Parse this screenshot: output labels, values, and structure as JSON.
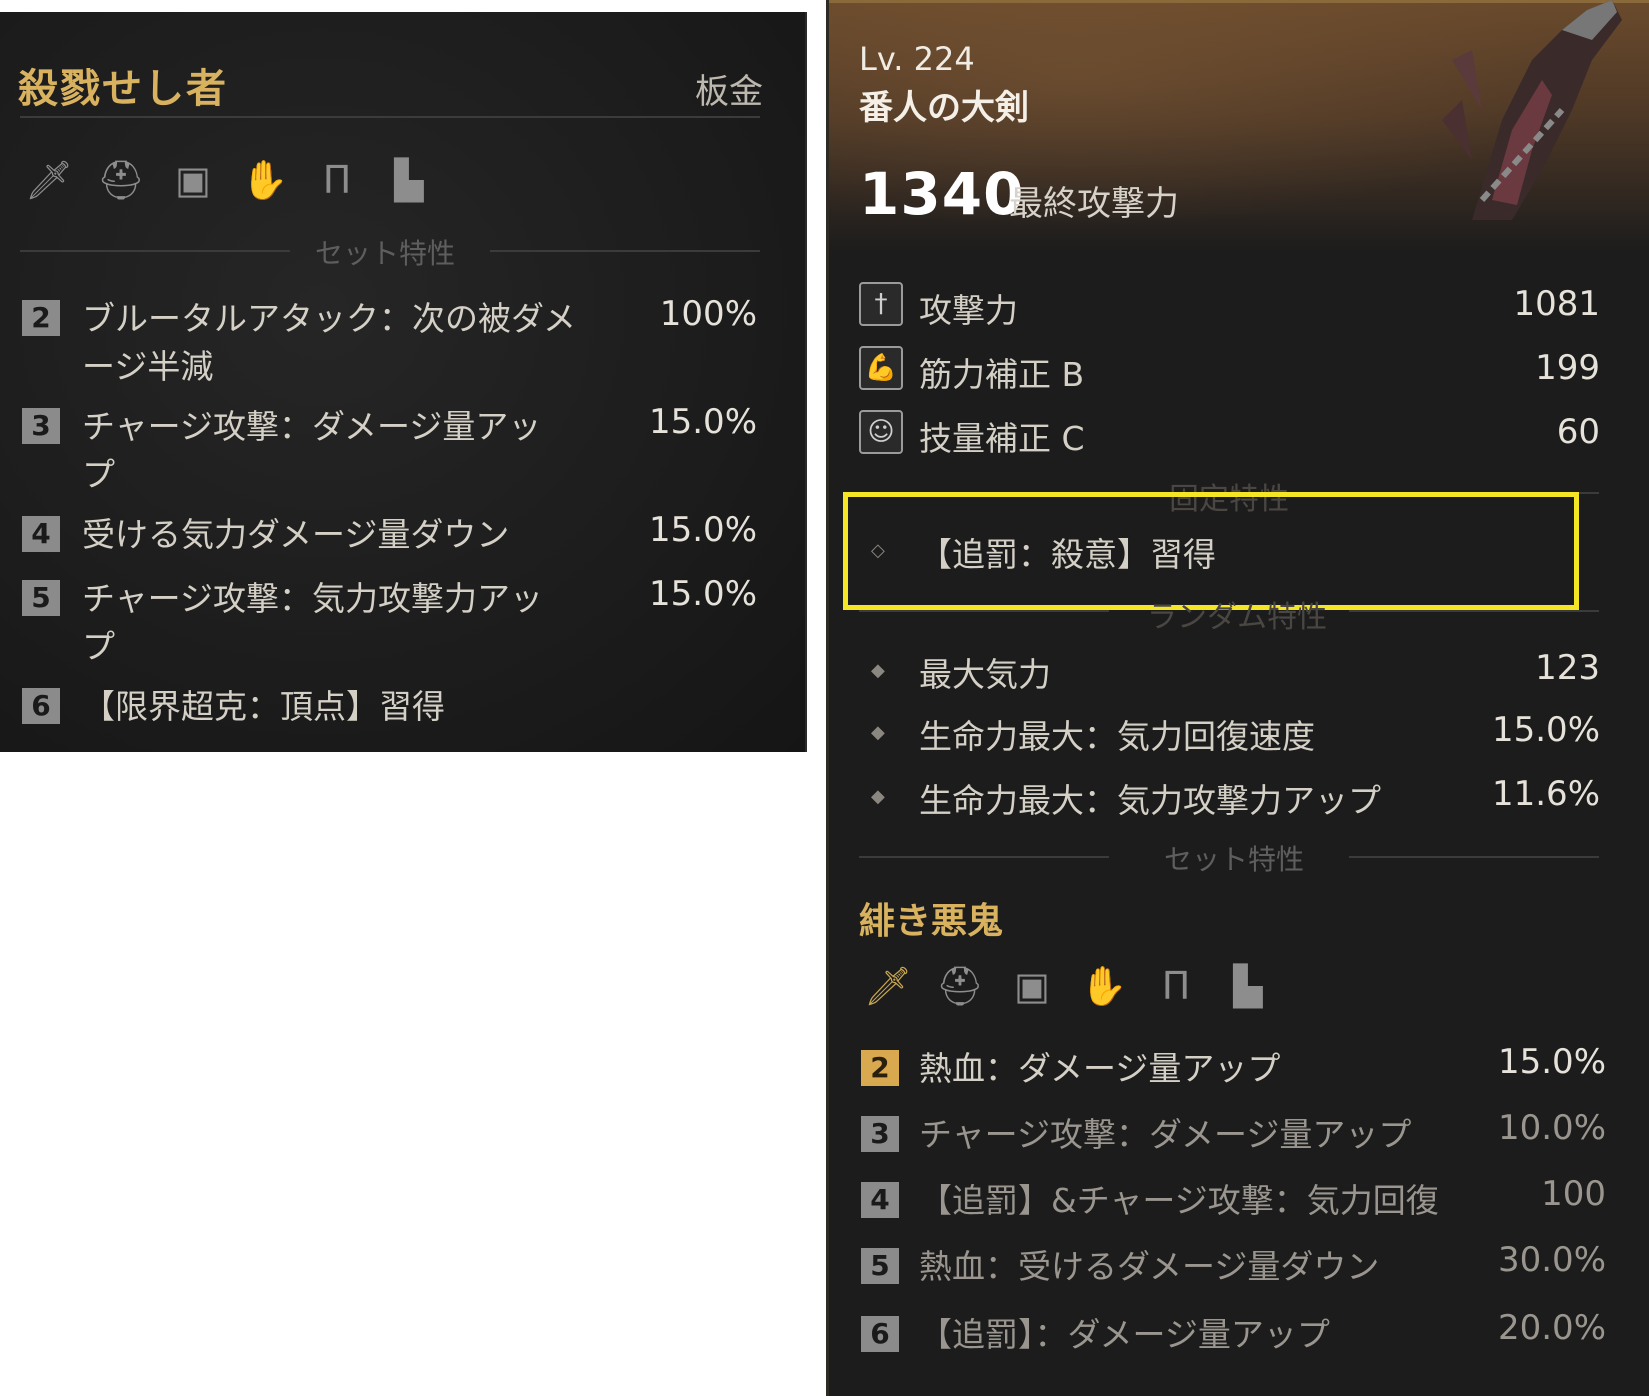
{
  "left_panel": {
    "title": "殺戮せし者",
    "material": "板金",
    "set_icons": [
      "sword-icon",
      "helmet-icon",
      "chest-armor-icon",
      "gauntlet-icon",
      "leg-armor-icon",
      "boots-icon"
    ],
    "section_label": "セット特性",
    "bonuses": [
      {
        "count": "2",
        "line1": "ブルータルアタック：次の被ダメ",
        "line2": "ージ半減",
        "value": "100%"
      },
      {
        "count": "3",
        "line1": "チャージ攻撃：ダメージ量アッ",
        "line2": "プ",
        "value": "15.0%"
      },
      {
        "count": "4",
        "line1": "受ける気力ダメージ量ダウン",
        "line2": "",
        "value": "15.0%"
      },
      {
        "count": "5",
        "line1": "チャージ攻撃：気力攻撃力アッ",
        "line2": "プ",
        "value": "15.0%"
      },
      {
        "count": "6",
        "line1": "【限界超克：頂点】習得",
        "line2": "",
        "value": ""
      }
    ]
  },
  "right_panel": {
    "level": "Lv. 224",
    "weapon_name": "番人の大剣",
    "final_attack": "1340",
    "final_attack_label": "最終攻撃力",
    "stats": [
      {
        "icon": "sword-stat-icon",
        "label": "攻撃力",
        "value": "1081"
      },
      {
        "icon": "strength-icon",
        "label": "筋力補正 B",
        "value": "199"
      },
      {
        "icon": "skill-icon",
        "label": "技量補正 C",
        "value": "60"
      }
    ],
    "fixed_section_label": "固定特性",
    "fixed_trait": "【追罰：殺意】習得",
    "random_section_label": "ランダム特性",
    "random_traits": [
      {
        "label": "最大気力",
        "value": "123"
      },
      {
        "label": "生命力最大：気力回復速度",
        "value": "15.0%"
      },
      {
        "label": "生命力最大：気力攻撃力アップ",
        "value": "11.6%"
      }
    ],
    "set_section_label": "セット特性",
    "set_name": "緋き悪鬼",
    "set_icons": [
      "sword-icon",
      "helmet-icon",
      "chest-armor-icon",
      "gauntlet-icon",
      "leg-armor-icon",
      "boots-icon"
    ],
    "set_bonuses": [
      {
        "count": "2",
        "label": "熱血：ダメージ量アップ",
        "value": "15.0%",
        "active": true
      },
      {
        "count": "3",
        "label": "チャージ攻撃：ダメージ量アップ",
        "value": "10.0%",
        "active": false
      },
      {
        "count": "4",
        "label": "【追罰】&チャージ攻撃：気力回復",
        "value": "100",
        "active": false
      },
      {
        "count": "5",
        "label": "熱血：受けるダメージ量ダウン",
        "value": "30.0%",
        "active": false
      },
      {
        "count": "6",
        "label": "【追罰】：ダメージ量アップ",
        "value": "20.0%",
        "active": false
      }
    ]
  },
  "colors": {
    "gold": "#d9b25f",
    "highlight": "#f5e625",
    "badge_active": "#d9a94f",
    "badge_inactive": "#8b8b8b"
  }
}
